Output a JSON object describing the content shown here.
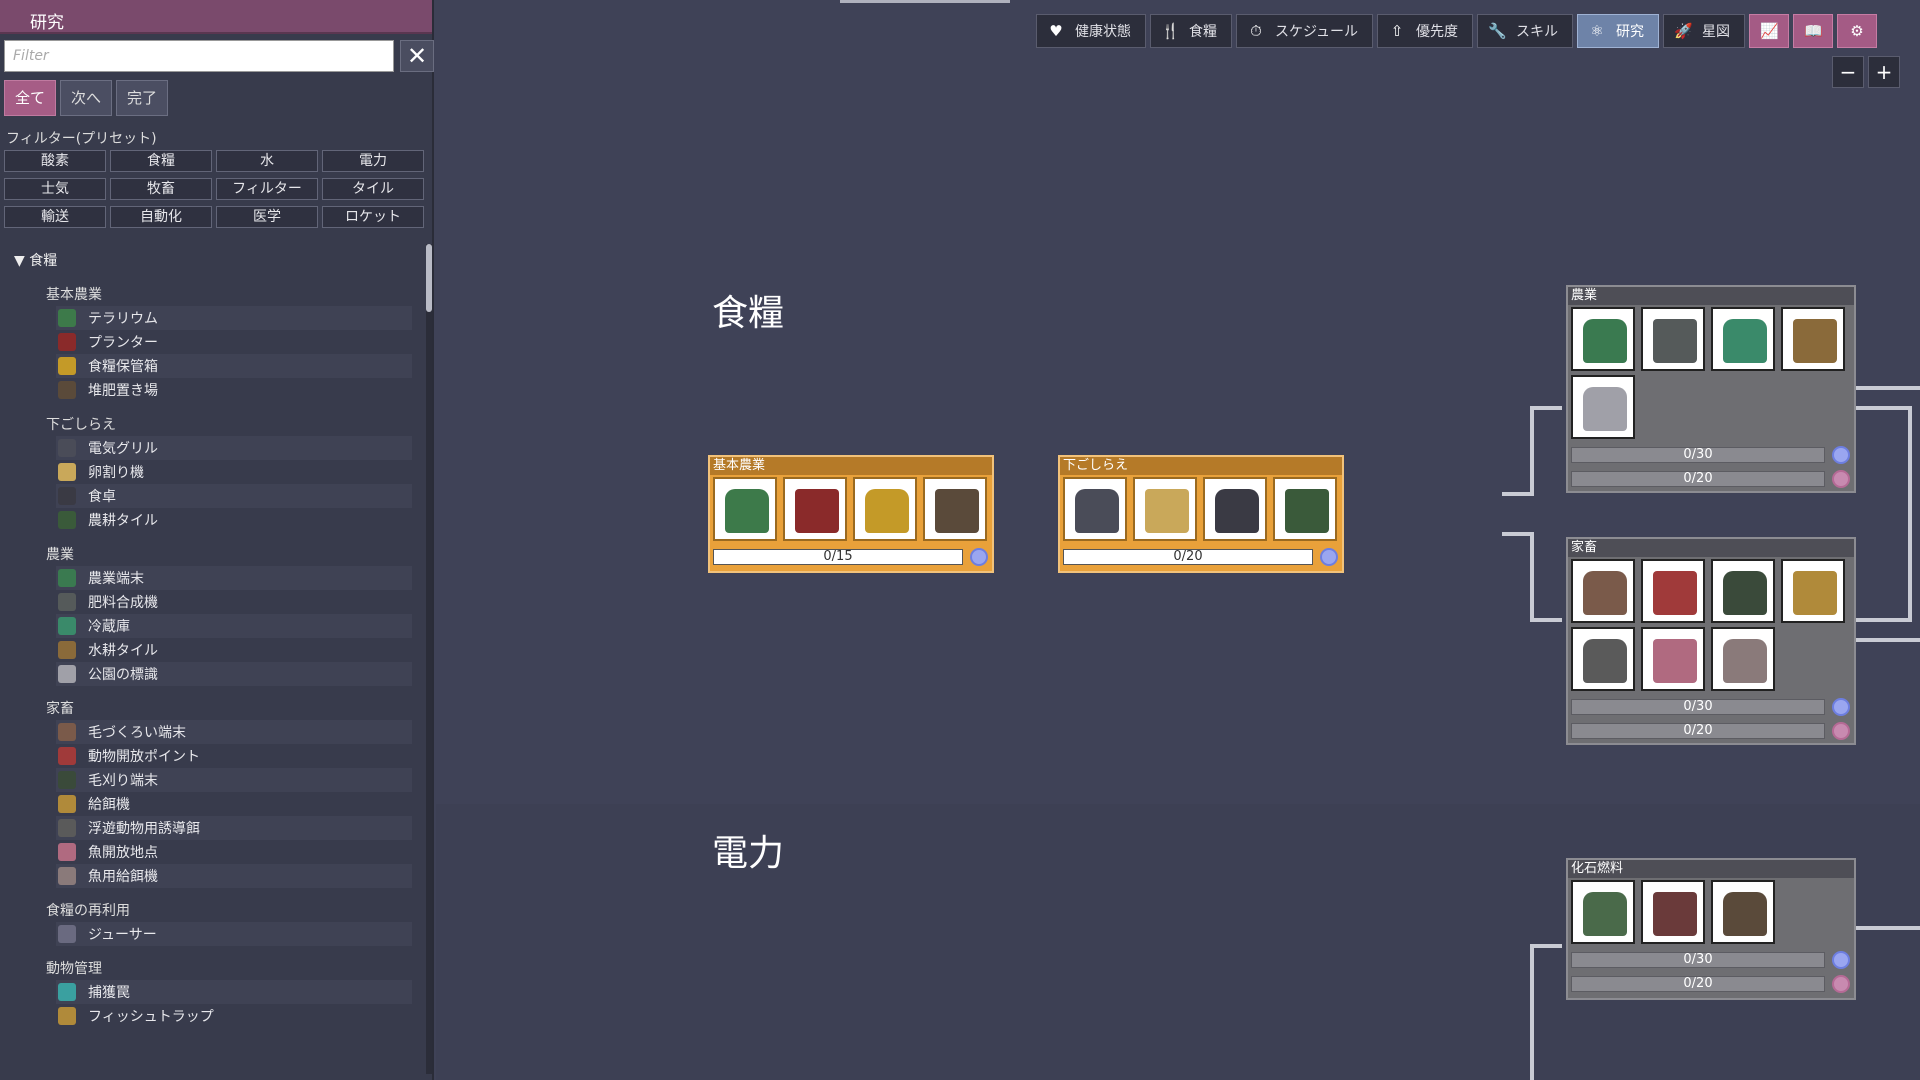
{
  "left_panel": {
    "title": "研究",
    "filter_placeholder": "Filter",
    "clear_label": "✕",
    "mode_tabs": [
      {
        "label": "全て"
      },
      {
        "label": "次へ"
      },
      {
        "label": "完了"
      }
    ],
    "preset_label": "フィルター(プリセット)",
    "presets": [
      "酸素",
      "食糧",
      "水",
      "電力",
      "士気",
      "牧畜",
      "フィルター",
      "タイル",
      "輸送",
      "自動化",
      "医学",
      "ロケット"
    ],
    "tree_root": "▼ 食糧",
    "groups": [
      {
        "title": "基本農業",
        "items": [
          {
            "label": "テラリウム",
            "color": "#3d7a4a"
          },
          {
            "label": "プランター",
            "color": "#8a2a2a"
          },
          {
            "label": "食糧保管箱",
            "color": "#c49a28"
          },
          {
            "label": "堆肥置き場",
            "color": "#5a4a3a"
          }
        ]
      },
      {
        "title": "下ごしらえ",
        "items": [
          {
            "label": "電気グリル",
            "color": "#4a4c58"
          },
          {
            "label": "卵割り機",
            "color": "#c9a85a"
          },
          {
            "label": "食卓",
            "color": "#3a3a44"
          },
          {
            "label": "農耕タイル",
            "color": "#3a5a3a"
          }
        ]
      },
      {
        "title": "農業",
        "items": [
          {
            "label": "農業端末",
            "color": "#3a7a50"
          },
          {
            "label": "肥料合成機",
            "color": "#555a5a"
          },
          {
            "label": "冷蔵庫",
            "color": "#3a8a6a"
          },
          {
            "label": "水耕タイル",
            "color": "#8a6a3a"
          },
          {
            "label": "公園の標識",
            "color": "#a0a0a8"
          }
        ]
      },
      {
        "title": "家畜",
        "items": [
          {
            "label": "毛づくろい端末",
            "color": "#7a5a4a"
          },
          {
            "label": "動物開放ポイント",
            "color": "#a03a3a"
          },
          {
            "label": "毛刈り端末",
            "color": "#3a4a3a"
          },
          {
            "label": "給餌機",
            "color": "#b08a3a"
          },
          {
            "label": "浮遊動物用誘導餌",
            "color": "#5a5a5a"
          },
          {
            "label": "魚開放地点",
            "color": "#b06a80"
          },
          {
            "label": "魚用給餌機",
            "color": "#8a7a7a"
          }
        ]
      },
      {
        "title": "食糧の再利用",
        "items": [
          {
            "label": "ジューサー",
            "color": "#6a6a80"
          }
        ]
      },
      {
        "title": "動物管理",
        "items": [
          {
            "label": "捕獲罠",
            "color": "#3aa0a0"
          },
          {
            "label": "フィッシュトラップ",
            "color": "#b08a3a"
          }
        ]
      }
    ]
  },
  "topbar": {
    "buttons": [
      {
        "label": "健康状態",
        "icon": "heart-icon",
        "glyph": "♥"
      },
      {
        "label": "食糧",
        "icon": "fork-icon",
        "glyph": "🍴"
      },
      {
        "label": "スケジュール",
        "icon": "stopwatch-icon",
        "glyph": "⏱"
      },
      {
        "label": "優先度",
        "icon": "priority-icon",
        "glyph": "⇧"
      },
      {
        "label": "スキル",
        "icon": "wrench-icon",
        "glyph": "🔧"
      },
      {
        "label": "研究",
        "icon": "research-icon",
        "glyph": "⚛",
        "active": true
      },
      {
        "label": "星図",
        "icon": "rocket-icon",
        "glyph": "🚀"
      }
    ],
    "icon_buttons": [
      {
        "icon": "chart-icon",
        "glyph": "📈"
      },
      {
        "icon": "book-icon",
        "glyph": "📖"
      },
      {
        "icon": "gear-icon",
        "glyph": "⚙"
      }
    ],
    "zoom_out": "−",
    "zoom_in": "+"
  },
  "sections": {
    "food": "食糧",
    "power": "電力"
  },
  "techs": {
    "basic_farming": {
      "title": "基本農業",
      "progress": "0/15",
      "state": "available",
      "icons": [
        "#3d7a4a",
        "#8a2a2a",
        "#c49a28",
        "#5a4a3a"
      ]
    },
    "meal_prep": {
      "title": "下ごしらえ",
      "progress": "0/20",
      "state": "available",
      "icons": [
        "#4a4c58",
        "#c9a85a",
        "#3a3a44",
        "#3a5a3a"
      ]
    },
    "agriculture": {
      "title": "農業",
      "progress": [
        "0/30",
        "0/20"
      ],
      "state": "locked",
      "icons": [
        "#3a7a50",
        "#555a5a",
        "#3a8a6a",
        "#8a6a3a",
        "#a0a0a8"
      ]
    },
    "ranching": {
      "title": "家畜",
      "progress": [
        "0/30",
        "0/20"
      ],
      "state": "locked",
      "icons": [
        "#7a5a4a",
        "#a03a3a",
        "#3a4a3a",
        "#b08a3a",
        "#5a5a5a",
        "#b06a80",
        "#8a7a7a"
      ]
    },
    "fossil_fuels": {
      "title": "化石燃料",
      "progress": [
        "0/30",
        "0/20"
      ],
      "state": "locked",
      "icons": [
        "#4a6a4a",
        "#6a3a3a",
        "#5a4a3a"
      ]
    }
  }
}
